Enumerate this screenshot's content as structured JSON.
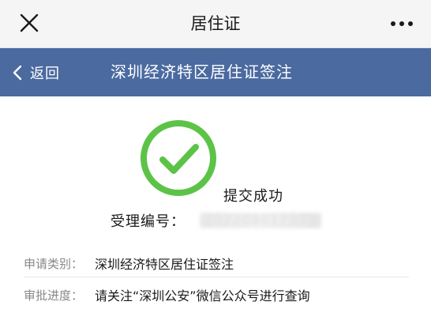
{
  "window": {
    "title": "居住证"
  },
  "navbar": {
    "back_label": "返回",
    "title": "深圳经济特区居住证签注",
    "background": "#4a6aa0"
  },
  "status": {
    "success_text": "提交成功",
    "icon_color": "#5cc347",
    "receipt_label": "受理编号：",
    "receipt_value": "202208017373"
  },
  "details": [
    {
      "label": "申请类别：",
      "value": "深圳经济特区居住证签注"
    },
    {
      "label": "审批进度：",
      "value": "请关注“深圳公安”微信公众号进行查询"
    }
  ]
}
